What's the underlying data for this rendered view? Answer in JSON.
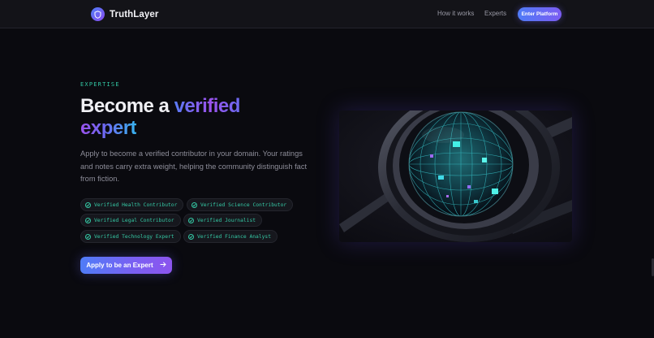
{
  "nav": {
    "brand": "TruthLayer",
    "links": [
      "How it works",
      "Experts"
    ],
    "cta": "Enter Platform"
  },
  "hero": {
    "eyebrow": "EXPERTISE",
    "title_prefix": "Become a",
    "title_highlight_1": "verified",
    "title_highlight_2": "expert",
    "description": "Apply to become a verified contributor in your domain. Your ratings and notes carry extra weight, helping the community distinguish fact from fiction.",
    "badges": [
      "Verified Health Contributor",
      "Verified Science Contributor",
      "Verified Legal Contributor",
      "Verified Journalist",
      "Verified Technology Expert",
      "Verified Finance Analyst"
    ],
    "apply_button": "Apply to be an Expert",
    "image_icon": "glowing-sphere-illustration"
  },
  "colors": {
    "accent_blue": "#4f7cf7",
    "accent_purple": "#8a4df0",
    "accent_teal": "#32c7a3",
    "background": "#0a0a0f"
  }
}
